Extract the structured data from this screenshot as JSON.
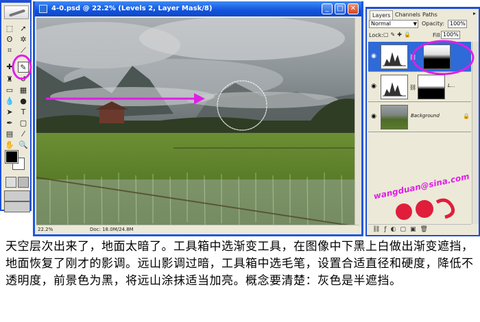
{
  "document": {
    "title": "4-0.psd @ 22.2% (Levels 2, Layer Mask/8)",
    "zoom": "22.2%",
    "doc_info": "Doc: 18.0M/24.8M"
  },
  "layers_panel": {
    "tabs": [
      "Layers",
      "Channels",
      "Paths"
    ],
    "blend_mode": "Normal",
    "opacity_label": "Opacity:",
    "opacity_value": "100%",
    "lock_label": "Lock:",
    "fill_label": "Fill:",
    "fill_value": "100%",
    "layers": [
      {
        "name": "",
        "visible": true,
        "selected": true,
        "has_mask": true
      },
      {
        "name": "L...",
        "visible": true,
        "selected": false,
        "has_mask": true
      },
      {
        "name": "Background",
        "visible": true,
        "selected": false,
        "has_mask": false
      }
    ]
  },
  "watermark": {
    "email": "wangduan@sina.com"
  },
  "caption": "天空层次出来了，地面太暗了。工具箱中选渐变工具，在图像中下黑上白做出渐变遮挡，地面恢复了刚才的影调。远山影调过暗，工具箱中选毛笔，设置合适直径和硬度，降低不透明度，前景色为黑，将远山涂抹适当加亮。概念要清楚：灰色是半遮挡。",
  "colors": {
    "annotation_magenta": "#e01ee8",
    "xp_blue": "#1d4fd6",
    "panel_bg": "#ece9d8"
  }
}
